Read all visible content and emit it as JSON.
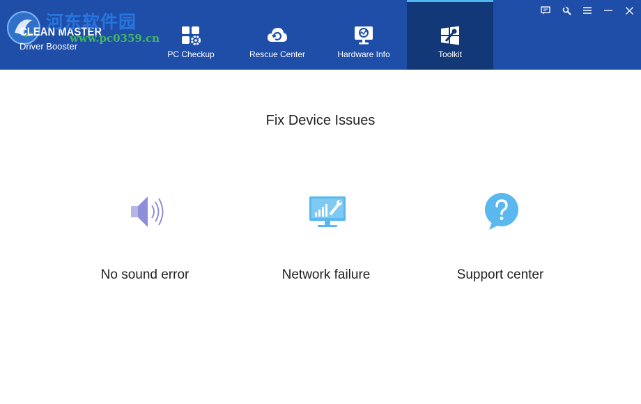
{
  "watermark": {
    "title": "河东软件园",
    "url": "www.pc0359.cn"
  },
  "app": {
    "name": "CLEAN MASTER",
    "subtitle": "Driver Booster"
  },
  "nav": {
    "tabs": [
      {
        "label": "PC Checkup",
        "icon": "grid-gear-icon",
        "active": false
      },
      {
        "label": "Rescue Center",
        "icon": "cloud-refresh-icon",
        "active": false
      },
      {
        "label": "Hardware Info",
        "icon": "monitor-chart-icon",
        "active": false
      },
      {
        "label": "Toolkit",
        "icon": "windows-wrench-icon",
        "active": true
      }
    ]
  },
  "window_controls": [
    "feedback-icon",
    "settings-wrench-icon",
    "menu-icon",
    "minimize-icon",
    "close-icon"
  ],
  "main": {
    "title": "Fix Device Issues",
    "tools": [
      {
        "label": "No sound error",
        "icon": "speaker-icon"
      },
      {
        "label": "Network failure",
        "icon": "monitor-network-repair-icon"
      },
      {
        "label": "Support center",
        "icon": "question-bubble-icon"
      }
    ]
  },
  "colors": {
    "header_bg": "#1f4ea8",
    "active_tab_bg": "#123878",
    "active_tab_accent": "#4fb6ee",
    "icon_blue": "#5ab8ee",
    "icon_purple": "#8f8ed8"
  }
}
